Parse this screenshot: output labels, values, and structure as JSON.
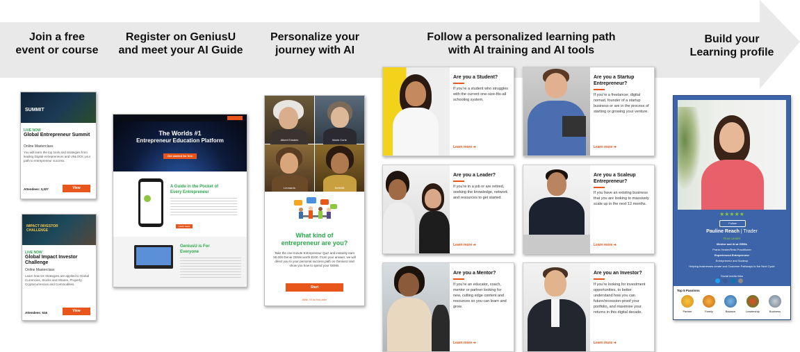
{
  "steps": [
    {
      "line1": "Join a free",
      "line2": "event or course"
    },
    {
      "line1": "Register on GeniusU",
      "line2": "and meet your AI Guide"
    },
    {
      "line1": "Personalize your",
      "line2": "journey with AI"
    },
    {
      "line1": "Follow a personalized learning path",
      "line2": "with AI training and AI tools"
    },
    {
      "line1": "Build your",
      "line2": "Learning profile"
    }
  ],
  "events": [
    {
      "banner": "SUMMIT",
      "tag": "LIVE NOW",
      "title": "Global Entrepreneur Summit",
      "sub": "Online Masterclass",
      "desc": "You will learn the top tools and strategies from leading Digital entrepreneurs and UNLOCK your path to entrepreneur success.",
      "att": "Attendees: 3,327",
      "btn": "View"
    },
    {
      "banner": "IMPACT INVESTOR CHALLENGE",
      "tag": "LIVE NOW",
      "title": "Global Impact Investor Challenge",
      "sub": "Online Masterclass",
      "desc": "Learn how 5X Strategies are applied to Global Currencies, Stocks and Shares, Property, Cryptocurrencies and Commodities.",
      "att": "Attendees: 516",
      "btn": "View"
    }
  ],
  "register": {
    "hero1": "The Worlds #1",
    "hero2": "Entrepreneur Education Platform",
    "hero_btn": "Get started for free",
    "guide1": "A Guide in the Pocket of",
    "guide2": "Every Entrepreneur",
    "guide_btn": "Learn more",
    "everyone1": "GeniusU is For",
    "everyone2": "Everyone"
  },
  "personalize": {
    "portraits": [
      "Albert Einstein",
      "Marie Curie",
      "Leonardo",
      "Nefertiti"
    ],
    "q1": "What kind of",
    "q2": "entrepreneur are you?",
    "desc": "Take the one minute Entrepreneur Quiz and instantly earn 50,000 Genie GEMs worth $100. From your answer, we will direct you to your personal success path on GeniusU and show you how to spend your GEMs.",
    "btn": "Start",
    "link": "Wait, I'll do this later"
  },
  "paths": [
    {
      "q": "Are you a Student?",
      "t": "If you're a student who struggles with the current one-size-fits-all schooling system.",
      "more": "Learn more"
    },
    {
      "q": "Are you a Startup Entrepreneur?",
      "t": "If you're a freelancer, digital nomad, founder of a startup business or are in the process of starting or growing your venture.",
      "more": "Learn more"
    },
    {
      "q": "Are you a Leader?",
      "t": "If you're in a job or are retired, seeking the knowledge, network and resources to get started.",
      "more": "Learn more"
    },
    {
      "q": "Are you a Scaleup Entrepreneur?",
      "t": "If you have an existing business that you are looking to massively scale up in the next 12 months.",
      "more": "Learn more"
    },
    {
      "q": "Are you a Mentor?",
      "t": "If you're an educator, coach, mentor or partner looking for new, cutting edge content and resources so you can learn and grow.",
      "more": "Learn more"
    },
    {
      "q": "Are you an Investor?",
      "t": "If you're looking for investment opportunities, to better understand how you can future/recession-proof your portfolio, and maximise your returns in this digital decade.",
      "more": "Learn more"
    }
  ],
  "profile": {
    "stars": "★★★★★",
    "follow": "Follow",
    "name": "Pauline Reach",
    "role": "| Trader",
    "level": "Flow Leader",
    "lines": [
      "Mentor and AI at GEMs",
      "Pranic Healer/Reiki Practitioner",
      "Experienced Entrepreneur",
      "Entrepreneur and Scaleup",
      "Helping businesses create and Customer Pathways to the Next Cycle"
    ],
    "social": "Social media links",
    "passions_title": "Top 5 Passions",
    "passions": [
      "Partner",
      "Family",
      "Balance",
      "Leadership",
      "Business"
    ]
  },
  "colors": {
    "accent": "#e8561b",
    "arrow": "#e9e9e9",
    "profile_bg": "#3d64a8",
    "green": "#8dc63f"
  }
}
